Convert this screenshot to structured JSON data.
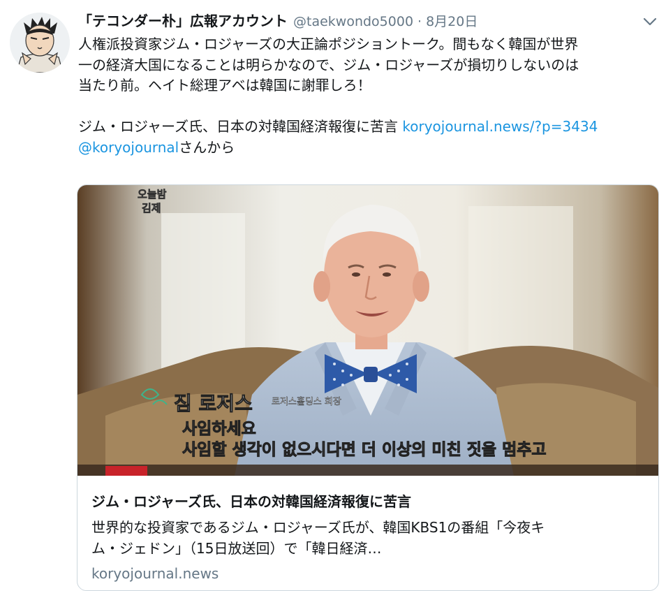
{
  "tweet": {
    "display_name": "「テコンダー朴」広報アカウント",
    "handle": "@taekwondo5000",
    "separator": "·",
    "timestamp": "8月20日",
    "text_lines": [
      "人権派投資家ジム・ロジャーズの大正論ポジショントーク。間もなく韓国が世界",
      "一の経済大国になることは明らかなので、ジム・ロジャーズが損切りしないのは",
      "当たり前。ヘイト総理アベは韓国に謝罪しろ！"
    ],
    "share_text": "ジム・ロジャーズ氏、日本の対韓国経済報復に苦言",
    "share_link": "koryojournal.news/?p=3434",
    "via_mention": "@koryojournal",
    "via_suffix": "さんから"
  },
  "card": {
    "image": {
      "caption_name": "짐 로저스",
      "caption_title": "로저스홀딩스 회장",
      "subtitle_line1": "사임하세요",
      "subtitle_line2": "사임할 생각이 없으시다면 더 이상의 미친 짓을 멈추고",
      "logo_line1": "오늘밤",
      "logo_line2": "김제"
    },
    "title": "ジム・ロジャーズ氏、日本の対韓国経済報復に苦言",
    "description_line1": "世界的な投資家であるジム・ロジャーズ氏が、韓国KBS1の番組「今夜キ",
    "description_line2": "ム・ジェドン」（15日放送回）で「韓日経済…",
    "domain": "koryojournal.news"
  },
  "colors": {
    "link": "#1b95e0",
    "muted": "#657786",
    "text": "#14171a",
    "border": "#ccd6dd"
  },
  "icons": {
    "menu": "chevron-down-icon",
    "avatar": "cartoon-avatar"
  }
}
